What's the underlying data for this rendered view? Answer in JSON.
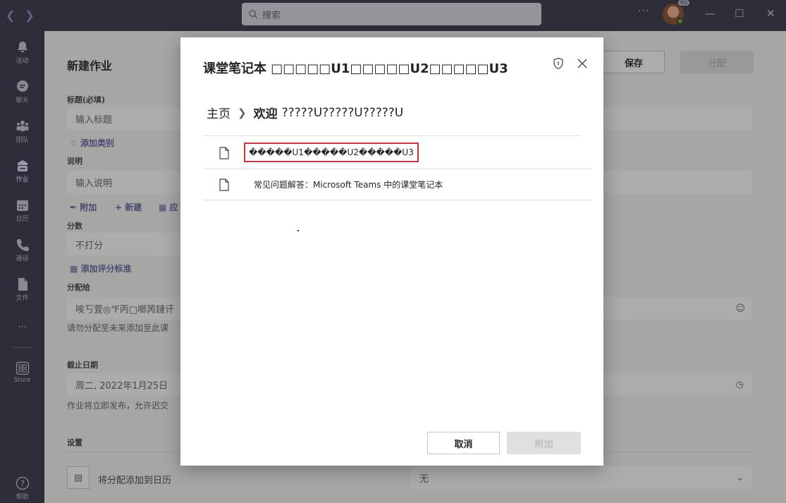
{
  "titlebar": {
    "search_placeholder": "搜索",
    "more": "···",
    "avatar_badge": "RD"
  },
  "rail": {
    "items": [
      {
        "label": "活动",
        "icon": "bell-icon"
      },
      {
        "label": "聊天",
        "icon": "chat-icon"
      },
      {
        "label": "团队",
        "icon": "teams-icon"
      },
      {
        "label": "作业",
        "icon": "assignments-icon"
      },
      {
        "label": "日历",
        "icon": "calendar-icon"
      },
      {
        "label": "通话",
        "icon": "phone-icon"
      },
      {
        "label": "文件",
        "icon": "file-icon"
      },
      {
        "label": "Store",
        "icon": "store-icon"
      },
      {
        "label": "帮助",
        "icon": "help-icon"
      }
    ],
    "more": "···"
  },
  "form": {
    "title": "新建作业",
    "save": "保存",
    "assign": "分配",
    "title_label": "标题(必填)",
    "title_placeholder": "输入标题",
    "add_category": "添加类别",
    "desc_label": "说明",
    "desc_placeholder": "输入说明",
    "attach": "附加",
    "new": "新建",
    "apply": "应",
    "points_label": "分数",
    "points_value": "不打分",
    "add_rubric": "添加评分标准",
    "assign_to_label": "分配给",
    "assign_to_value": "唉丂萱◎℉丙□啷苪鏈讦",
    "assign_hint": "请勿分配至未来添加至此课",
    "due_label": "截止日期",
    "due_value": "周二, 2022年1月25日",
    "due_hint": "作业将立即发布，允许迟交",
    "settings_label": "设置",
    "calendar_label": "将分配添加到日历",
    "calendar_value": "无"
  },
  "dialog": {
    "title": "课堂笔记本 □□□□□U1□□□□□U2□□□□□U3",
    "breadcrumb": {
      "home": "主页",
      "current": "欢迎",
      "current_sub": "?????U?????U?????U"
    },
    "items": [
      {
        "name": "�����U1�����U2�����U3",
        "selected": true
      },
      {
        "name": "常见问题解答：Microsoft Teams 中的课堂笔记本",
        "selected": false
      }
    ],
    "cancel": "取消",
    "attach": "附加"
  }
}
